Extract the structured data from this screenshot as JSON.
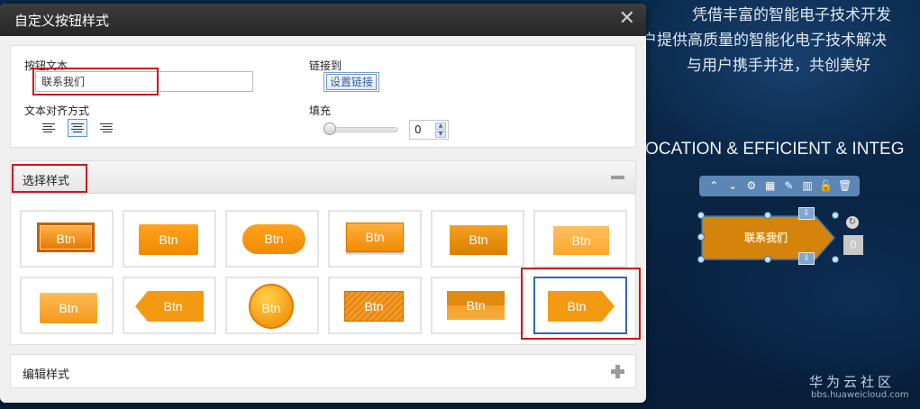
{
  "background": {
    "lines": [
      "凭借丰富的智能电子技术开发",
      "户提供高质量的智能化电子技术解决",
      "与用户携手并进，共创美好"
    ],
    "tagline": "OCATION & EFFICIENT & INTEG",
    "canvas_button_text": "联系我们",
    "zero_label": "0",
    "watermark": "华为云社区",
    "watermark_url": "bbs.huaweicloud.com"
  },
  "dialog": {
    "title": "自定义按钮样式",
    "close_glyph": "✕",
    "button_text_label": "按钮文本",
    "button_text_value": "联系我们",
    "align_label": "文本对齐方式",
    "link_label": "链接到",
    "link_button": "设置链接",
    "fill_label": "填充",
    "fill_value": "0",
    "choose_style": "选择样式",
    "edit_style": "编辑样式",
    "sample_label": "Btn",
    "selected_style_index": 11
  },
  "colors": {
    "accent_orange": "#f39c12",
    "highlight_red": "#d0141a",
    "selected_blue": "#2e66b8"
  }
}
